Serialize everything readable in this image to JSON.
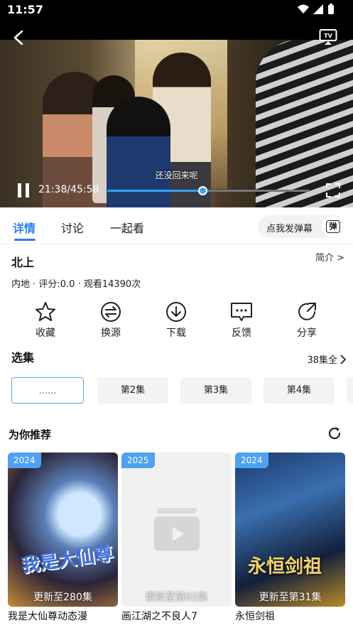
{
  "status_bar": {
    "time": "11:57"
  },
  "player": {
    "subtitle": "还没回来呢",
    "time_display": "21:38/45:58",
    "progress": 0.47
  },
  "tabs": [
    {
      "label": "详情"
    },
    {
      "label": "讨论"
    },
    {
      "label": "一起看"
    }
  ],
  "danmaku": {
    "placeholder": "点我发弹幕",
    "icon_text": "弹"
  },
  "detail": {
    "title": "北上",
    "intro_link": "简介 >",
    "meta": "内地 · 评分:0.0 · 观看14390次"
  },
  "actions": [
    {
      "label": "收藏",
      "icon": "star-icon"
    },
    {
      "label": "换源",
      "icon": "switch-source-icon"
    },
    {
      "label": "下载",
      "icon": "download-icon"
    },
    {
      "label": "反馈",
      "icon": "feedback-icon"
    },
    {
      "label": "分享",
      "icon": "share-icon"
    }
  ],
  "episodes": {
    "heading": "选集",
    "total": "38集全",
    "items": [
      "......",
      "第2集",
      "第3集",
      "第4集"
    ]
  },
  "recommend": {
    "heading": "为你推荐",
    "cards": [
      {
        "year": "2024",
        "update": "更新至280集",
        "name": "我是大仙尊动态漫",
        "art_text": "我是大仙尊"
      },
      {
        "year": "2025",
        "update": "更新至第02集",
        "name": "画江湖之不良人7"
      },
      {
        "year": "2024",
        "update": "更新至第31集",
        "name": "永恒剑祖",
        "art_text": "永恒剑祖"
      }
    ]
  },
  "colors": {
    "accent": "#2d7ff5",
    "badge": "#4ea1f3"
  }
}
